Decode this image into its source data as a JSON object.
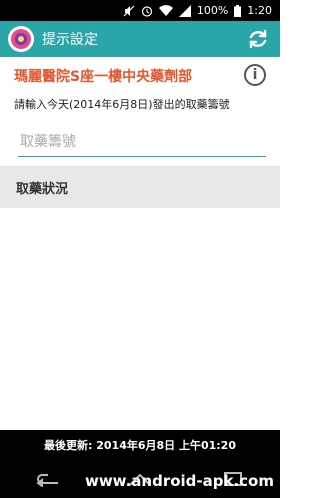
{
  "status_bar": {
    "battery_percent": "100%",
    "time": "1:20"
  },
  "app_bar": {
    "title": "提示設定"
  },
  "hospital": {
    "name": "瑪麗醫院S座一樓中央藥劑部"
  },
  "instruction": "請輸入今天(2014年6月8日)發出的取藥籌號",
  "number_input": {
    "value": "",
    "placeholder": "取藥籌號"
  },
  "section": {
    "title": "取藥狀況"
  },
  "footer": {
    "last_updated": "最後更新: 2014年6月8日 上午01:20"
  },
  "watermark": "www.android-apk.com",
  "colors": {
    "app_bar": "#2aa6a8",
    "hospital_name": "#e4572e",
    "section_bg": "#e8e8e8"
  }
}
